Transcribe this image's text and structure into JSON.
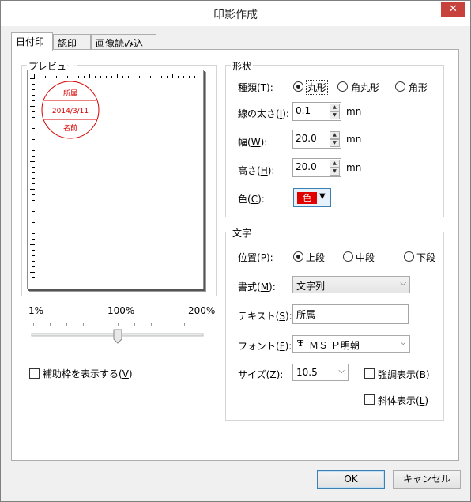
{
  "window": {
    "title": "印影作成",
    "close_glyph": "✕"
  },
  "tabs": [
    {
      "label": "日付印"
    },
    {
      "label": "認印"
    },
    {
      "label": "画像読み込み"
    }
  ],
  "preview": {
    "group_label": "プレビュー",
    "stamp": {
      "top_text": "所属",
      "date_text": "2014/3/11",
      "bottom_text": "名前",
      "color": "#d40000"
    },
    "zoom": {
      "min_label": "1%",
      "mid_label": "100%",
      "max_label": "200%",
      "value_percent": 100
    },
    "guide_checkbox": {
      "label": "補助枠を表示する(",
      "key": "V",
      "end": ")",
      "checked": false
    }
  },
  "shape": {
    "group_label": "形状",
    "type": {
      "label_pre": "種類(",
      "key": "T",
      "label_post": "):",
      "options": [
        "丸形",
        "角丸形",
        "角形"
      ],
      "selected": "丸形"
    },
    "line_width": {
      "label_pre": "線の太さ(",
      "key": "I",
      "label_post": "):",
      "value": "0.1",
      "unit": "mn"
    },
    "width": {
      "label_pre": "幅(",
      "key": "W",
      "label_post": "):",
      "value": "20.0",
      "unit": "mn"
    },
    "height": {
      "label_pre": "高さ(",
      "key": "H",
      "label_post": "):",
      "value": "20.0",
      "unit": "mn"
    },
    "color": {
      "label_pre": "色(",
      "key": "C",
      "label_post": "):",
      "value": "色",
      "swatch": "#e00000"
    }
  },
  "text": {
    "group_label": "文字",
    "position": {
      "label_pre": "位置(",
      "key": "P",
      "label_post": "):",
      "options": [
        "上段",
        "中段",
        "下段"
      ],
      "selected": "上段"
    },
    "format": {
      "label_pre": "書式(",
      "key": "M",
      "label_post": "):",
      "value": "文字列"
    },
    "text_value": {
      "label_pre": "テキスト(",
      "key": "S",
      "label_post": "):",
      "value": "所属"
    },
    "font": {
      "label_pre": "フォント(",
      "key": "F",
      "label_post": "):",
      "value": "ＭＳ Ｐ明朝",
      "icon_glyph": "Ŧ"
    },
    "size": {
      "label_pre": "サイズ(",
      "key": "Z",
      "label_post": "):",
      "value": "10.5"
    },
    "bold": {
      "label_pre": "強調表示(",
      "key": "B",
      "label_post": ")",
      "checked": false
    },
    "italic": {
      "label_pre": "斜体表示(",
      "key": "L",
      "label_post": ")",
      "checked": false
    }
  },
  "buttons": {
    "ok": "OK",
    "cancel": "キャンセル"
  }
}
